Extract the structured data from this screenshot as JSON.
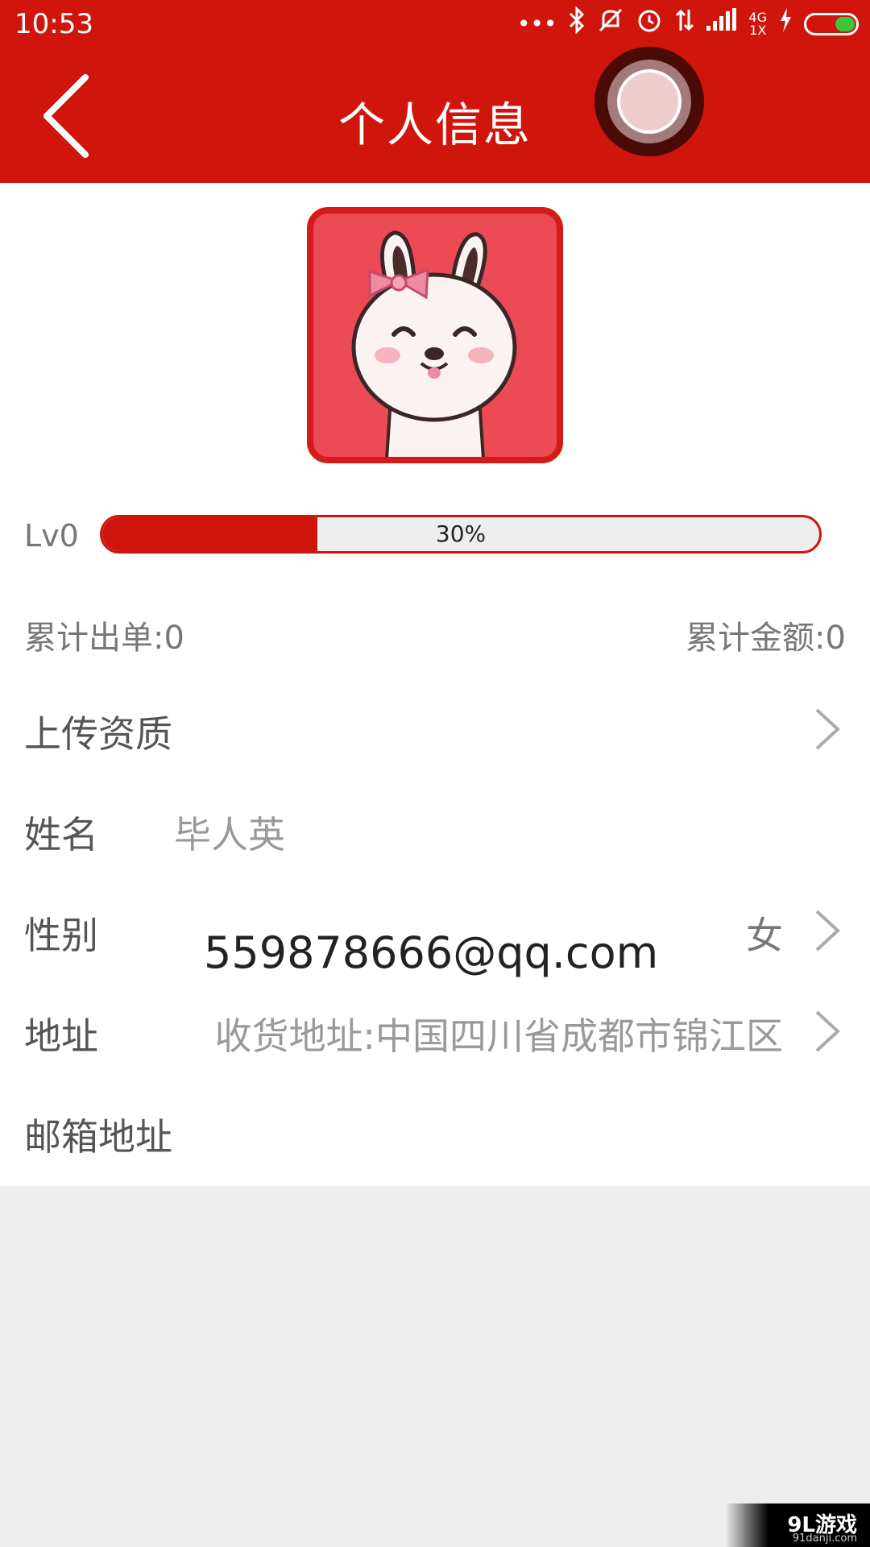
{
  "status_bar": {
    "time": "10:53",
    "network_top": "4G",
    "network_bottom": "1X",
    "icons": [
      "dots-icon",
      "bluetooth-icon",
      "mute-icon",
      "alarm-icon",
      "data-arrows-icon",
      "signal-icon",
      "charging-icon",
      "battery-icon"
    ]
  },
  "header": {
    "title": "个人信息",
    "back_icon": "chevron-left-icon"
  },
  "profile": {
    "level": "Lv0",
    "progress_text": "30%",
    "progress_fraction": 0.3,
    "orders_total": "累计出单:0",
    "amount_total": "累计金额:0"
  },
  "rows": {
    "qualification": {
      "label": "上传资质"
    },
    "name": {
      "label": "姓名",
      "value": "毕人英"
    },
    "gender": {
      "label": "性别",
      "value": "女"
    },
    "address": {
      "label": "地址",
      "value": "收货地址:中国四川省成都市锦江区"
    },
    "email": {
      "label": "邮箱地址",
      "value": "559878666@qq.com"
    }
  },
  "watermark": {
    "main": "9L游戏",
    "sub": "91danji.com"
  },
  "colors": {
    "brand_red": "#d0160c",
    "avatar_bg": "#ec4a55",
    "page_bg": "#ededed"
  }
}
